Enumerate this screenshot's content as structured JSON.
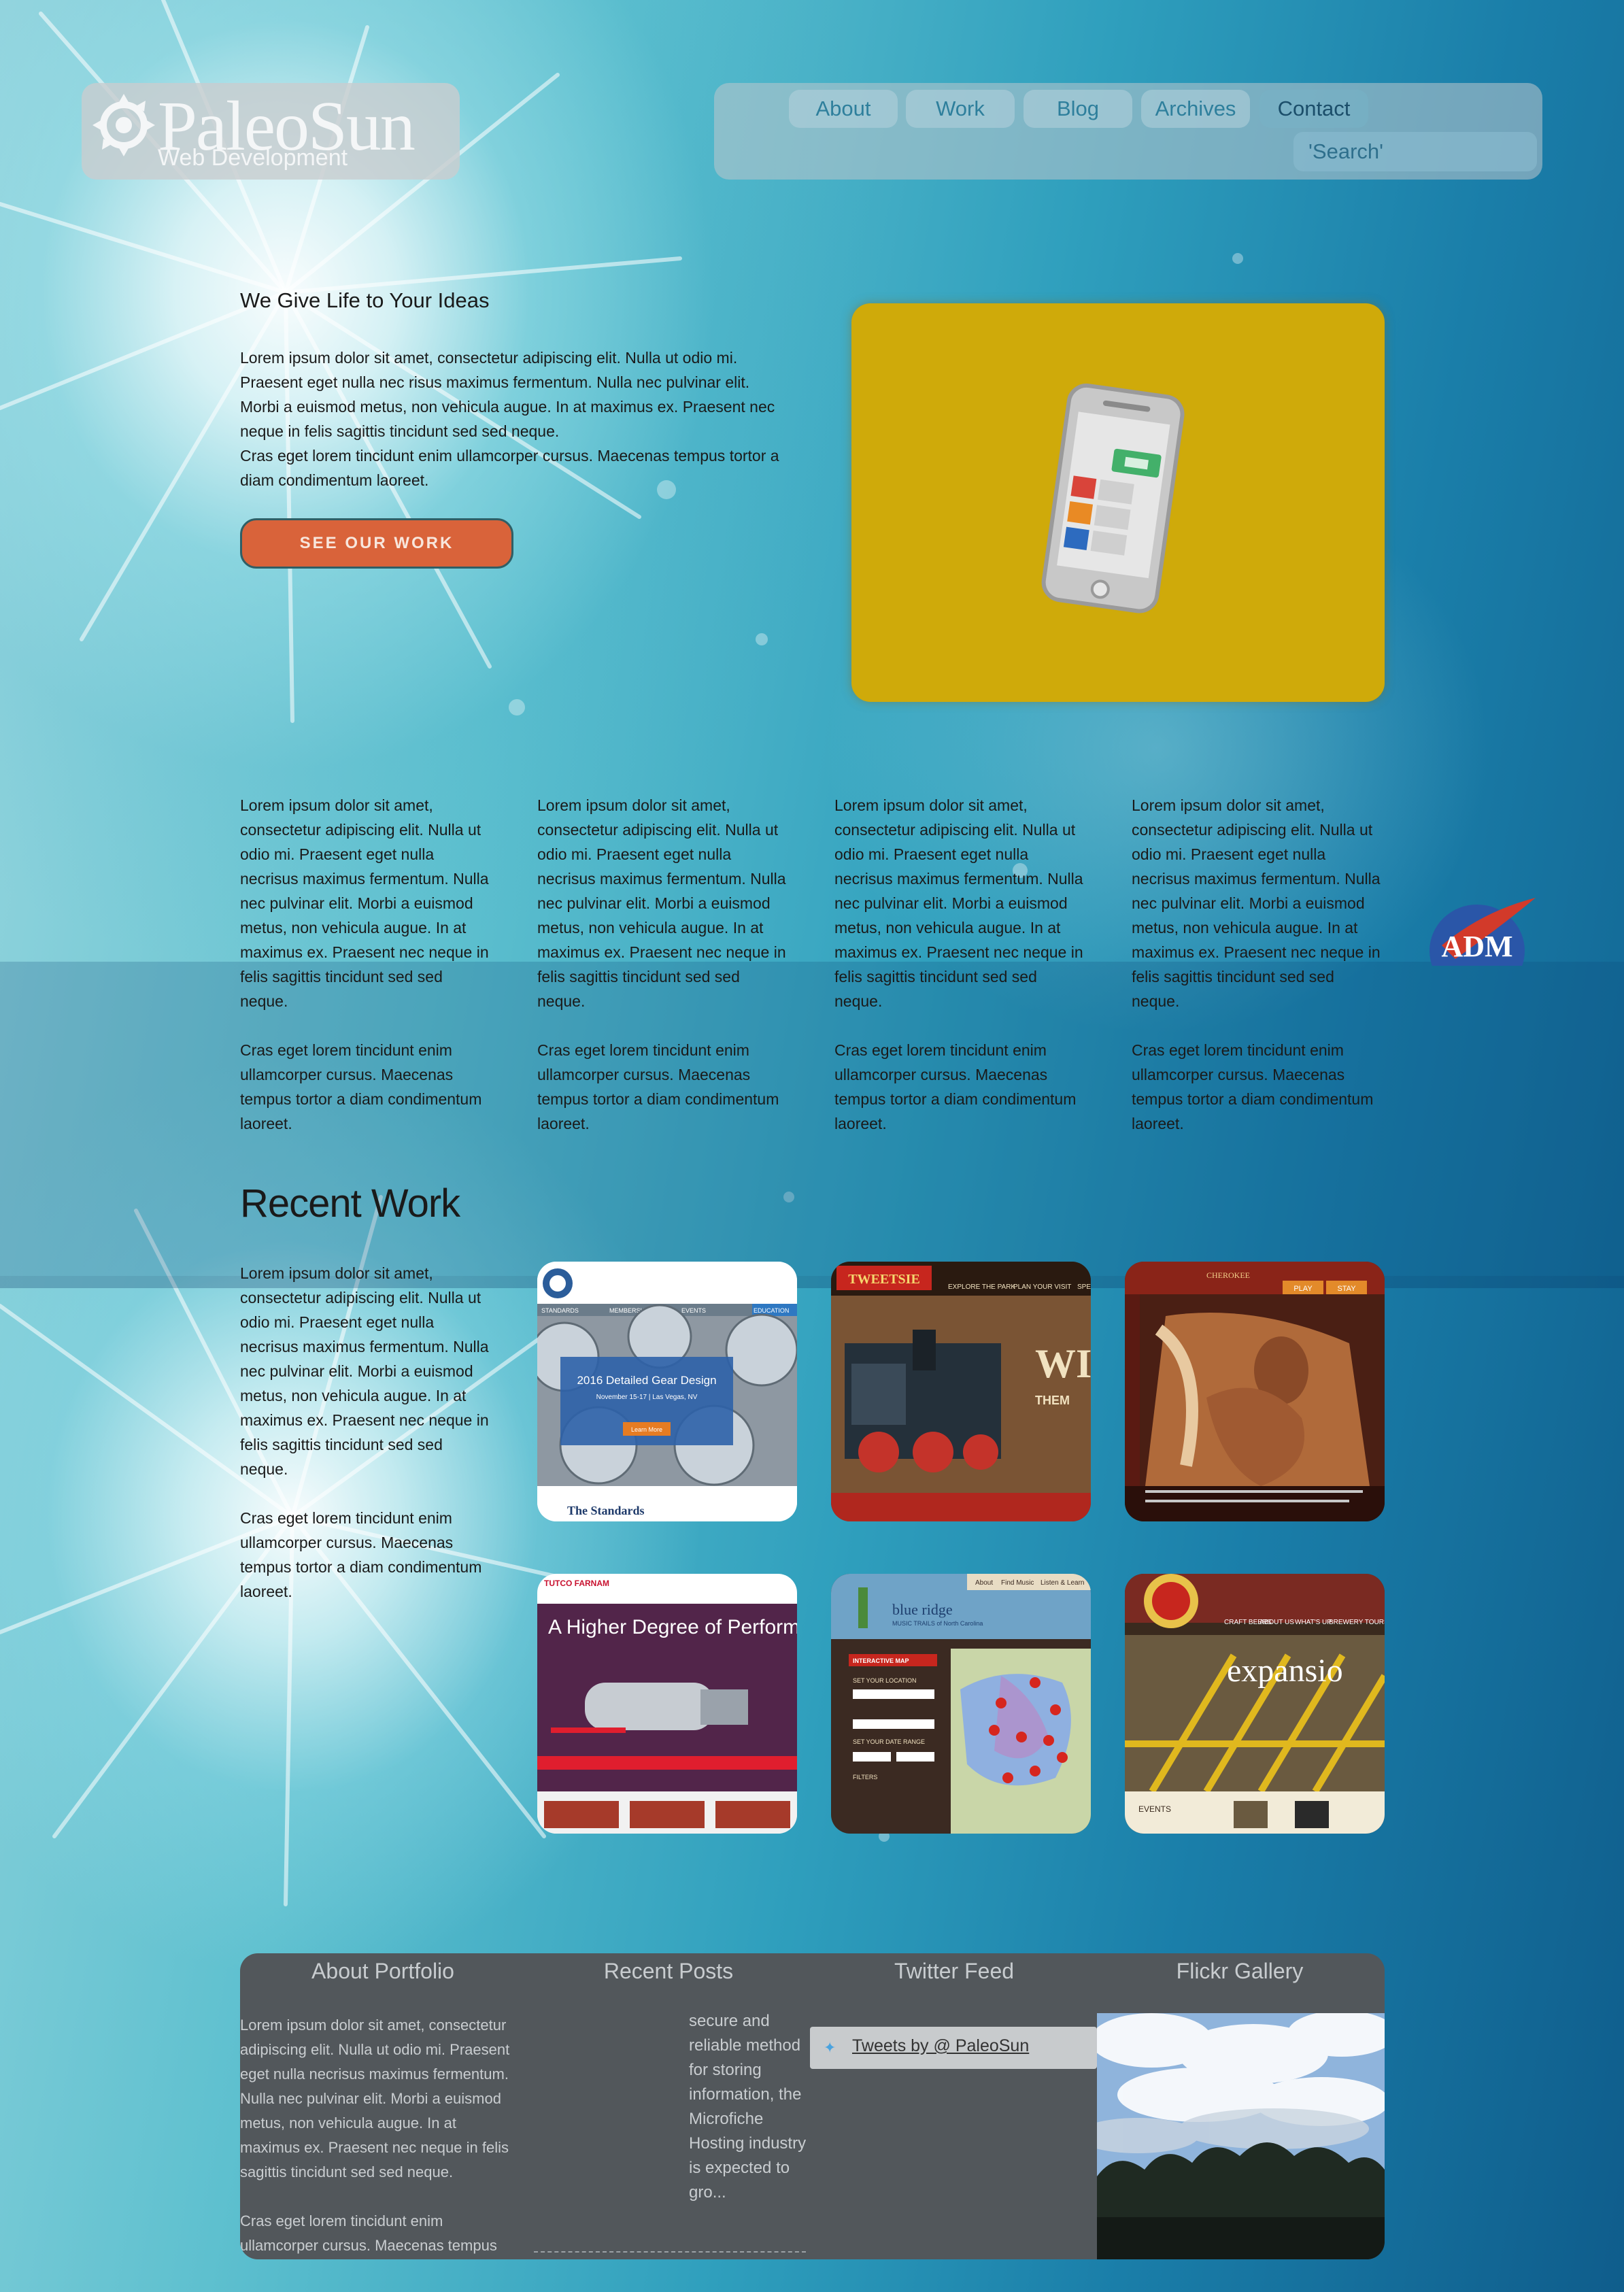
{
  "header": {
    "logo": {
      "name": "PaleoSun",
      "subtitle": "Web Development"
    },
    "nav": [
      {
        "label": "About"
      },
      {
        "label": "Work"
      },
      {
        "label": "Blog"
      },
      {
        "label": "Archives"
      },
      {
        "label": "Contact"
      }
    ],
    "search_placeholder": "'Search'"
  },
  "hero": {
    "title": "We Give Life to Your Ideas",
    "paragraph1": "Lorem ipsum dolor sit amet, consectetur adipiscing elit. Nulla ut odio mi. Praesent eget nulla nec risus maximus fermentum. Nulla nec pulvinar elit. Morbi a euismod metus, non vehicula augue. In at maximus ex. Praesent nec neque in felis sagittis tincidunt sed sed neque.",
    "paragraph2": "Cras eget lorem tincidunt enim ullamcorper cursus. Maecenas tempus tortor a diam condimentum laoreet.",
    "cta_label": "SEE OUR WORK",
    "image_icon": "smartphone-icon",
    "image_bg": "#cfaa0a"
  },
  "columns": [
    {
      "p1": "Lorem ipsum dolor sit amet, consectetur adipiscing elit. Nulla ut odio mi. Praesent eget nulla necrisus maximus fermentum. Nulla nec pulvinar elit. Morbi a euismod metus, non vehicula augue. In at maximus ex. Praesent nec neque in felis sagittis tincidunt sed sed neque.",
      "p2": "Cras eget lorem tincidunt enim ullamcorper cursus. Maecenas tempus tortor a diam condimentum laoreet."
    },
    {
      "p1": "Lorem ipsum dolor sit amet, consectetur adipiscing elit. Nulla ut odio mi. Praesent eget nulla necrisus maximus fermentum. Nulla nec pulvinar elit. Morbi a euismod metus, non vehicula augue. In at maximus ex. Praesent nec neque in felis sagittis tincidunt sed sed neque.",
      "p2": "Cras eget lorem tincidunt enim ullamcorper cursus. Maecenas tempus tortor a diam condimentum laoreet."
    },
    {
      "p1": "Lorem ipsum dolor sit amet, consectetur adipiscing elit. Nulla ut odio mi. Praesent eget nulla necrisus maximus fermentum. Nulla nec pulvinar elit. Morbi a euismod metus, non vehicula augue. In at maximus ex. Praesent nec neque in felis sagittis tincidunt sed sed neque.",
      "p2": "Cras eget lorem tincidunt enim ullamcorper cursus. Maecenas tempus tortor a diam condimentum laoreet."
    },
    {
      "p1": "Lorem ipsum dolor sit amet, consectetur adipiscing elit. Nulla ut odio mi. Praesent eget nulla necrisus maximus fermentum. Nulla nec pulvinar elit. Morbi a euismod metus, non vehicula augue. In at maximus ex. Praesent nec neque in felis sagittis tincidunt sed sed neque.",
      "p2": "Cras eget lorem tincidunt enim ullamcorper cursus. Maecenas tempus tortor a diam condimentum laoreet."
    }
  ],
  "recent_work": {
    "title": "Recent Work",
    "p1": "Lorem ipsum dolor sit amet, consectetur adipiscing elit. Nulla ut odio mi. Praesent eget nulla necrisus maximus fermentum. Nulla nec pulvinar elit. Morbi a euismod metus, non vehicula augue. In at maximus ex. Praesent nec neque in felis sagittis tincidunt sed sed neque.",
    "p2": "Cras eget lorem tincidunt enim ullamcorper cursus. Maecenas tempus tortor a diam condimentum laoreet.",
    "thumbnails": [
      {
        "site": "gear-standards",
        "heading": "2016 Detailed Gear Design",
        "sub": "November 15-17 | Las Vegas, NV",
        "button": "Learn More",
        "footer": "The Standards",
        "tabs": [
          "STANDARDS",
          "MEMBERSHIP",
          "EVENTS",
          "EDUCATION"
        ]
      },
      {
        "site": "tweetsie",
        "logo": "TWEETSIE",
        "nav": [
          "EXPLORE THE PARK",
          "PLAN YOUR VISIT",
          "SPE"
        ],
        "big": "WI",
        "sub": "THEM"
      },
      {
        "site": "cherokee",
        "logo": "CHEROKEE",
        "buttons": [
          "PLAY",
          "STAY"
        ]
      },
      {
        "site": "tutco",
        "logo": "TUTCO FARNAM",
        "headline": "A Higher Degree of Performan"
      },
      {
        "site": "blue-ridge",
        "logo": "blue ridge",
        "sub": "MUSIC TRAILS of North Carolina",
        "tabs": [
          "About",
          "Find Music",
          "Listen & Learn"
        ],
        "panel": [
          "INTERACTIVE MAP",
          "SET YOUR LOCATION",
          "SET YOUR DATE RANGE",
          "FILTERS"
        ]
      },
      {
        "site": "brewery",
        "big": "expansio",
        "nav": [
          "CRAFT BEERS",
          "ABOUT US",
          "WHAT'S UP",
          "BREWERY TOURS"
        ],
        "footer": "EVENTS"
      }
    ]
  },
  "footer": {
    "headings": [
      "About Portfolio",
      "Recent Posts",
      "Twitter Feed",
      "Flickr Gallery"
    ],
    "about_p1": "Lorem ipsum dolor sit amet, consectetur adipiscing elit. Nulla ut odio mi. Praesent eget nulla necrisus maximus fermentum. Nulla nec pulvinar elit. Morbi a euismod metus, non vehicula augue. In at maximus ex. Praesent nec neque in felis sagittis tincidunt sed sed neque.",
    "about_p2": "Cras eget lorem tincidunt enim ullamcorper cursus. Maecenas tempus",
    "post_excerpt": "secure and reliable method for storing information, the Microfiche Hosting industry is expected to gro...",
    "twitter_link": "Tweets by @ PaleoSun",
    "twitter_icon": "twitter-bird-icon",
    "flickr_image": "sky-and-trees-photo"
  },
  "colors": {
    "accent": "#d9633a",
    "nav_text": "#2e7f9c",
    "footer_bg": "#52575b",
    "hero_image_bg": "#cfaa0a"
  },
  "badge": {
    "text": "ADM"
  }
}
